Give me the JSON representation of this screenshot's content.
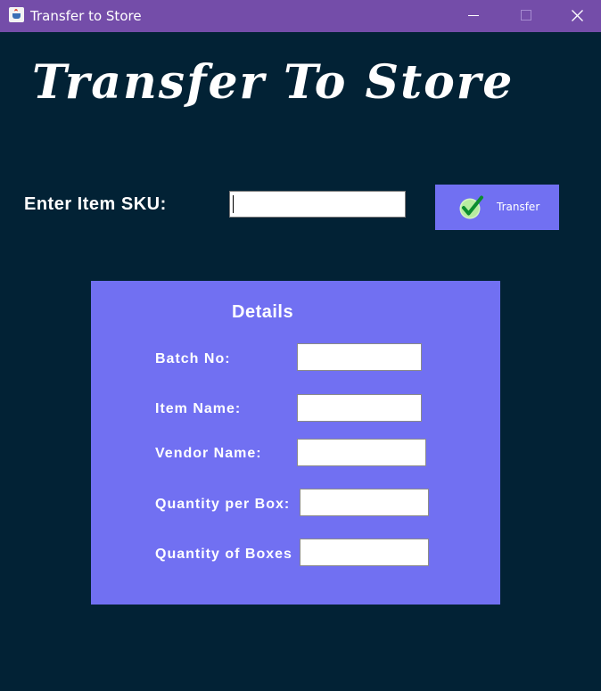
{
  "window": {
    "title": "Transfer to Store",
    "titlebar_color": "#744da9",
    "background_color": "#022235",
    "icons": {
      "app": "java-cup-icon",
      "minimize": "minimize-icon",
      "maximize": "maximize-icon",
      "close": "close-icon"
    }
  },
  "heading": {
    "text": "Transfer To Store"
  },
  "sku": {
    "label": "Enter Item SKU:",
    "value": "",
    "placeholder": ""
  },
  "transfer_button": {
    "label": "Transfer",
    "icon": "green-check-icon",
    "color": "#7170f2"
  },
  "details": {
    "title": "Details",
    "panel_color": "#7170f2",
    "fields": [
      {
        "label": "Batch No:",
        "value": ""
      },
      {
        "label": "Item  Name:",
        "value": ""
      },
      {
        "label": "Vendor Name:",
        "value": ""
      },
      {
        "label": "Quantity per Box:",
        "value": ""
      },
      {
        "label": "Quantity of Boxes",
        "value": ""
      }
    ]
  }
}
